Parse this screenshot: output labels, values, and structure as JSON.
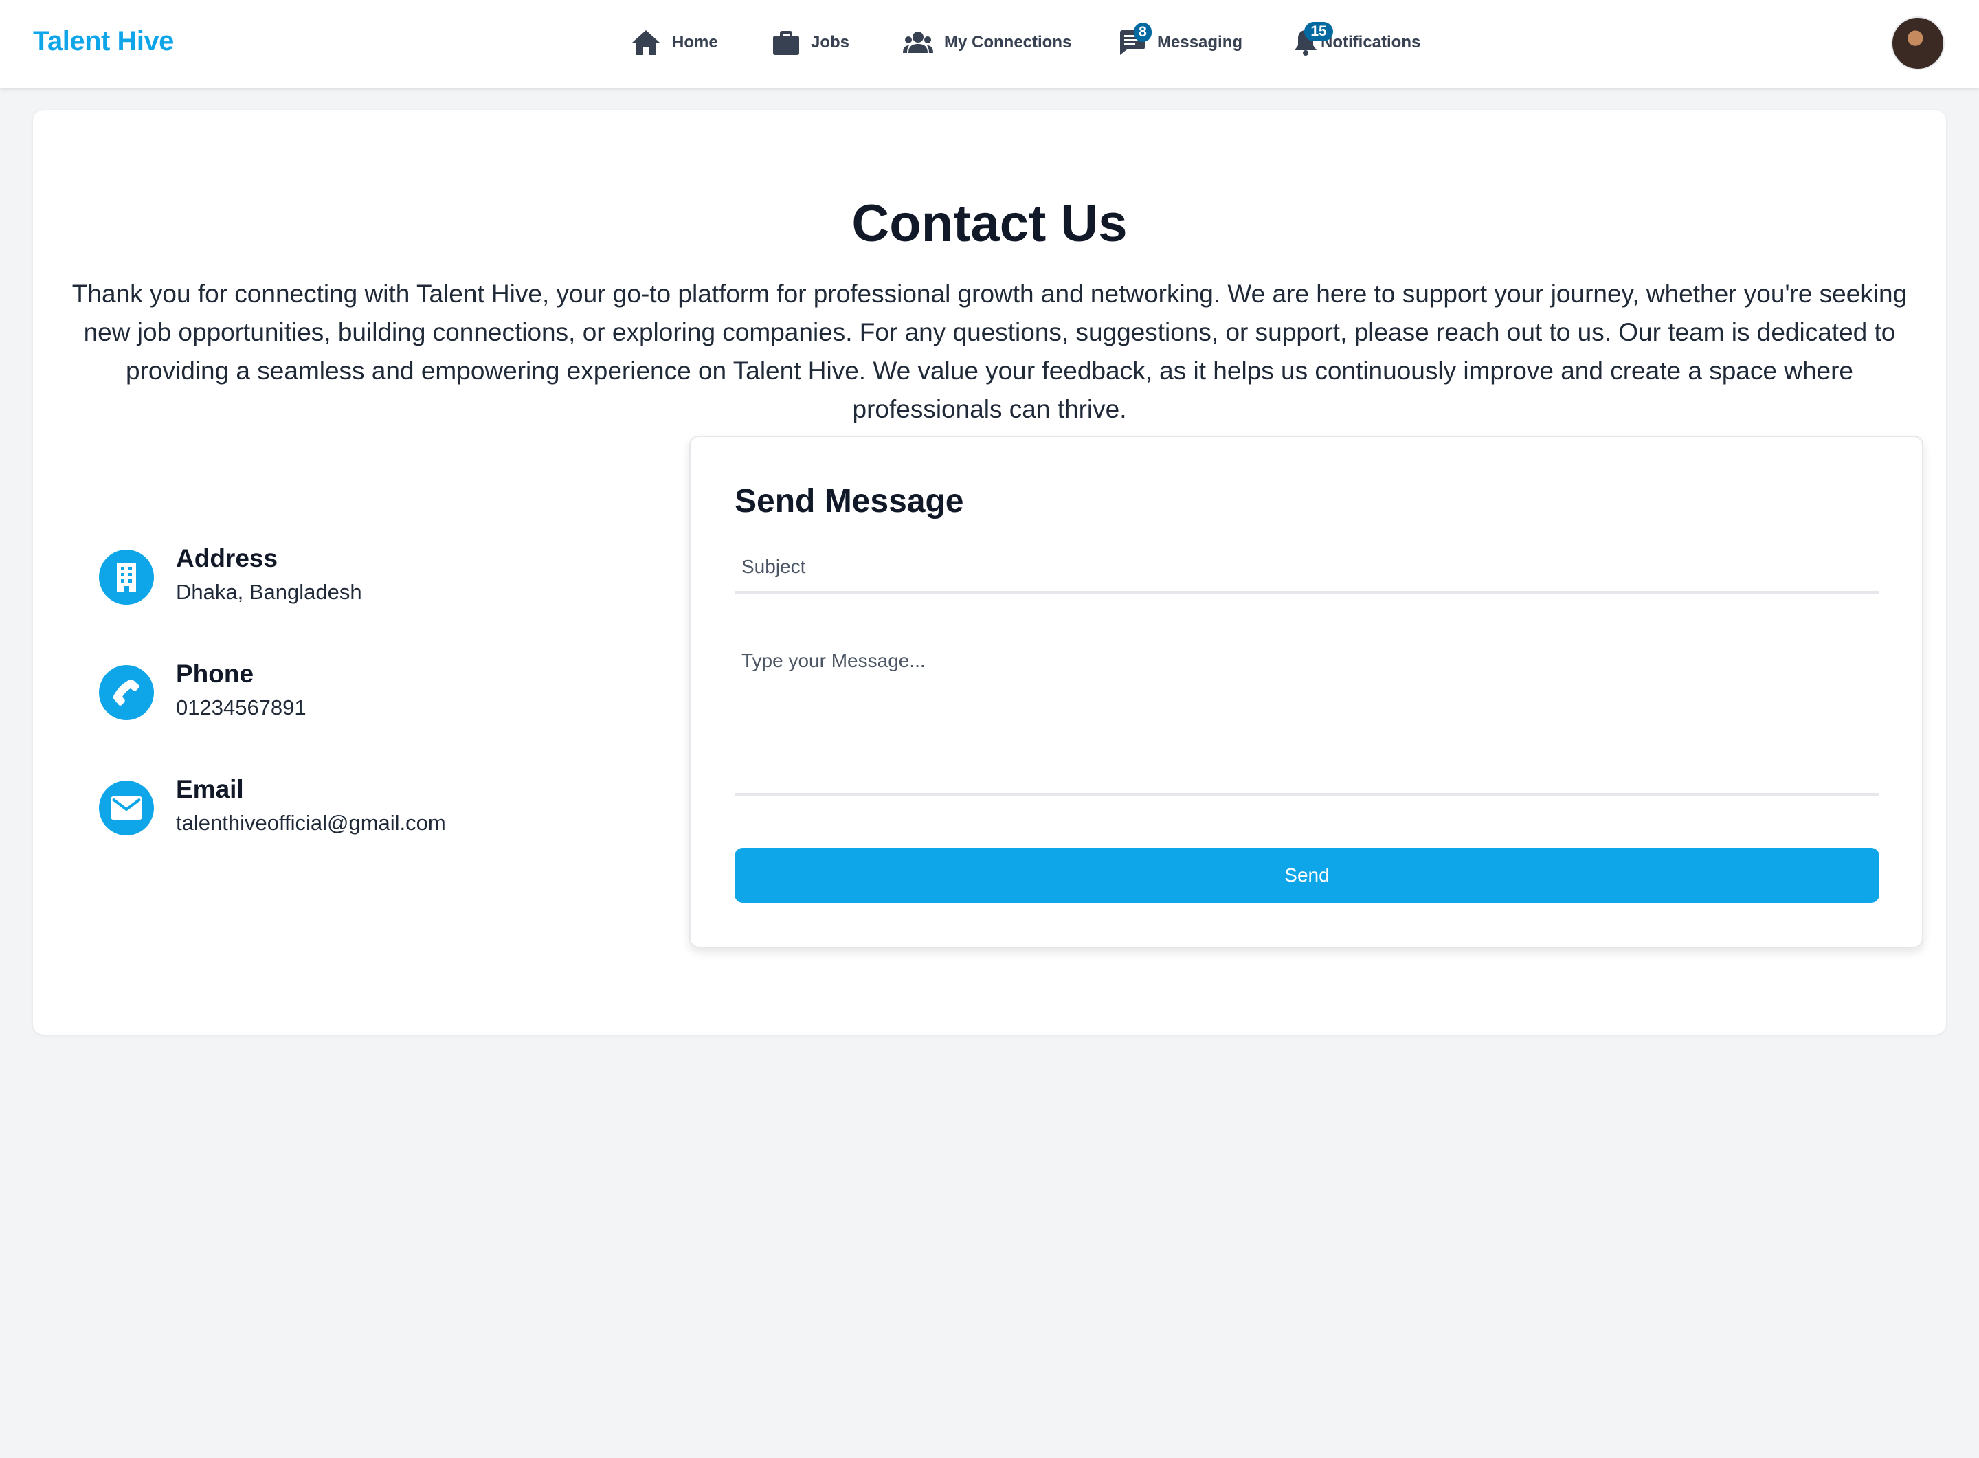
{
  "header": {
    "brand": "Talent Hive",
    "nav": [
      {
        "label": "Home",
        "icon": "home-icon"
      },
      {
        "label": "Jobs",
        "icon": "briefcase-icon"
      },
      {
        "label": "My Connections",
        "icon": "users-icon"
      },
      {
        "label": "Messaging",
        "icon": "message-icon",
        "badge": "8"
      },
      {
        "label": "Notifications",
        "icon": "bell-icon",
        "badge": "15"
      }
    ],
    "avatar_icon": "user-avatar"
  },
  "contact": {
    "title": "Contact Us",
    "intro": "Thank you for connecting with Talent Hive, your go-to platform for professional growth and networking. We are here to support your journey, whether you're seeking new job opportunities, building connections, or exploring companies. For any questions, suggestions, or support, please reach out to us. Our team is dedicated to providing a seamless and empowering experience on Talent Hive. We value your feedback, as it helps us continuously improve and create a space where professionals can thrive.",
    "info": [
      {
        "label": "Address",
        "value": "Dhaka, Bangladesh",
        "icon": "building-icon"
      },
      {
        "label": "Phone",
        "value": "01234567891",
        "icon": "phone-icon"
      },
      {
        "label": "Email",
        "value": "talenthiveofficial@gmail.com",
        "icon": "envelope-icon"
      }
    ]
  },
  "form": {
    "title": "Send Message",
    "subject_placeholder": "Subject",
    "subject_value": "",
    "message_placeholder": "Type your Message...",
    "message_value": "",
    "send_label": "Send"
  },
  "colors": {
    "accent": "#0ea5e9",
    "badge": "#0369a1",
    "background": "#f3f4f6"
  }
}
